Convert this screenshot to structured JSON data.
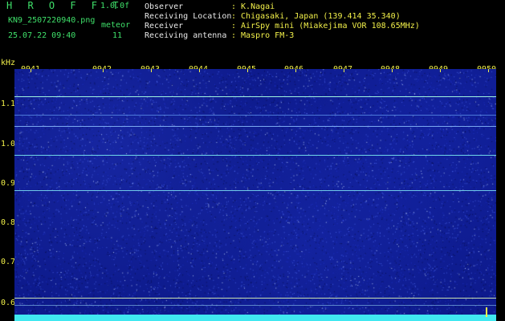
{
  "app": {
    "title": "H R O F F T",
    "version": "1.0.0f"
  },
  "file": {
    "name": "KN9_2507220940.png",
    "datetime": "25.07.22 09:40"
  },
  "meteor": {
    "label": "meteor",
    "count": "11"
  },
  "info": [
    {
      "label": "Observer",
      "value": ": K.Nagai"
    },
    {
      "label": "Receiving Location",
      "value": ": Chigasaki, Japan (139.414 35.340)"
    },
    {
      "label": "Receiver",
      "value": ": AirSpy mini (Miakejima VOR 108.65MHz)"
    },
    {
      "label": "Receiving antenna",
      "value": ": Maspro FM-3"
    }
  ],
  "axis": {
    "unit": "kHz",
    "x_ticks": [
      "0941",
      "0942",
      "0943",
      "0944",
      "0945",
      "0946",
      "0947",
      "0948",
      "0949",
      "0950"
    ],
    "y_ticks": [
      "1.1",
      "1.0",
      "0.9",
      "0.8",
      "0.7",
      "0.6"
    ]
  },
  "colors": {
    "background": "#0d1a8c",
    "carrier": "#40e8f0",
    "labels": "#f2f04a",
    "header": "#3fe06a"
  }
}
